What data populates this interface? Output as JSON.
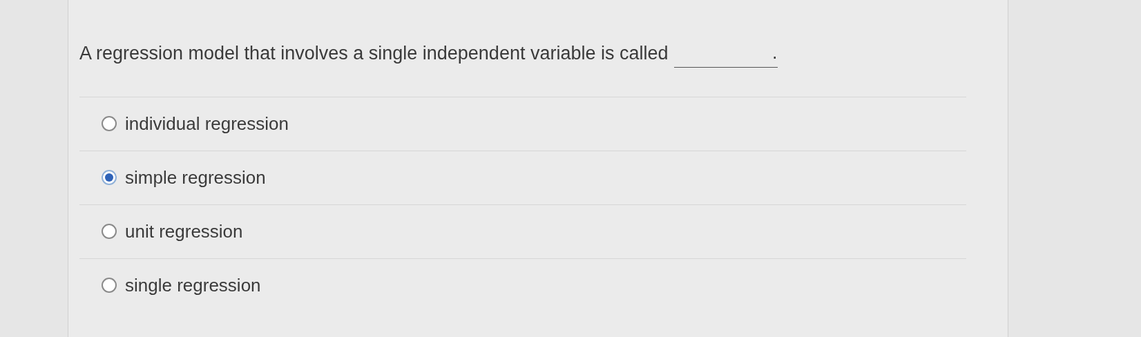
{
  "question": {
    "text": "A regression model that involves a single independent variable is called",
    "blank_end": "."
  },
  "options": [
    {
      "label": "individual regression",
      "selected": false
    },
    {
      "label": "simple regression",
      "selected": true
    },
    {
      "label": "unit regression",
      "selected": false
    },
    {
      "label": "single regression",
      "selected": false
    }
  ]
}
